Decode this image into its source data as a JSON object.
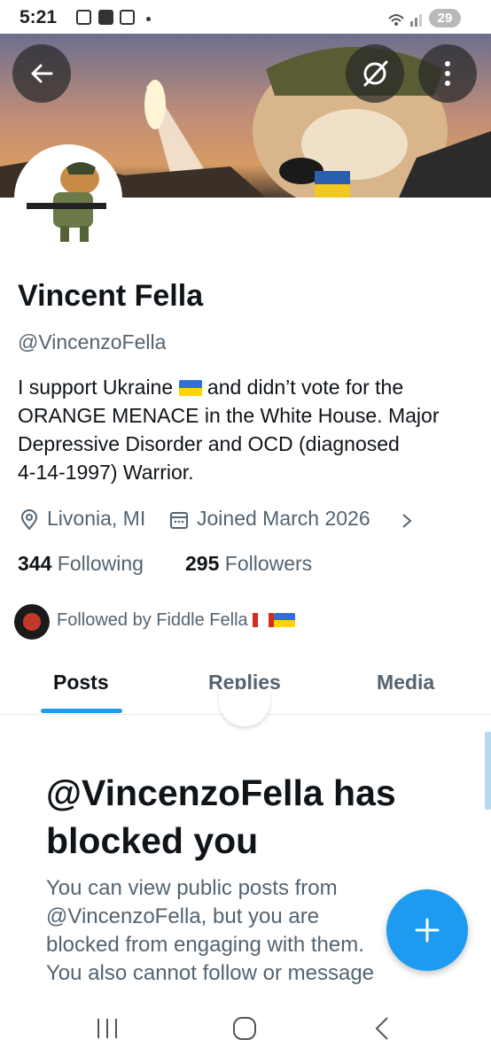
{
  "status_bar": {
    "time": "5:21",
    "battery": "29"
  },
  "profile": {
    "name": "Vincent Fella",
    "handle": "@VincenzoFella",
    "bio_lines": [
      "I support Ukraine",
      "and didn’t vote for the",
      "ORANGE MENACE in the White House. Major",
      "Depressive Disorder and OCD (diagnosed",
      "4-14-1997) Warrior."
    ],
    "location": "Livonia, MI",
    "joined": "Joined March 2026",
    "following_count": "344",
    "following_label": "Following",
    "followers_count": "295",
    "followers_label": "Followers",
    "followed_by": "Followed by Fiddle Fella"
  },
  "tabs": [
    {
      "label": "Posts",
      "active": true
    },
    {
      "label": "Replies",
      "active": false
    },
    {
      "label": "Media",
      "active": false
    }
  ],
  "blocked": {
    "title": "@VincenzoFella has blocked you",
    "message_lines": [
      "You can view public posts from",
      "@VincenzoFella, but you are",
      "blocked from engaging with them.",
      "You also cannot follow or message"
    ]
  },
  "colors": {
    "accent": "#1d9bf0",
    "text_primary": "#0f1419",
    "text_secondary": "#536471"
  },
  "icons": [
    "back-arrow-icon",
    "grok-icon",
    "more-vertical-icon",
    "location-pin-icon",
    "calendar-icon",
    "chevron-right-icon",
    "plus-icon",
    "recents-icon",
    "home-icon",
    "back-icon"
  ]
}
